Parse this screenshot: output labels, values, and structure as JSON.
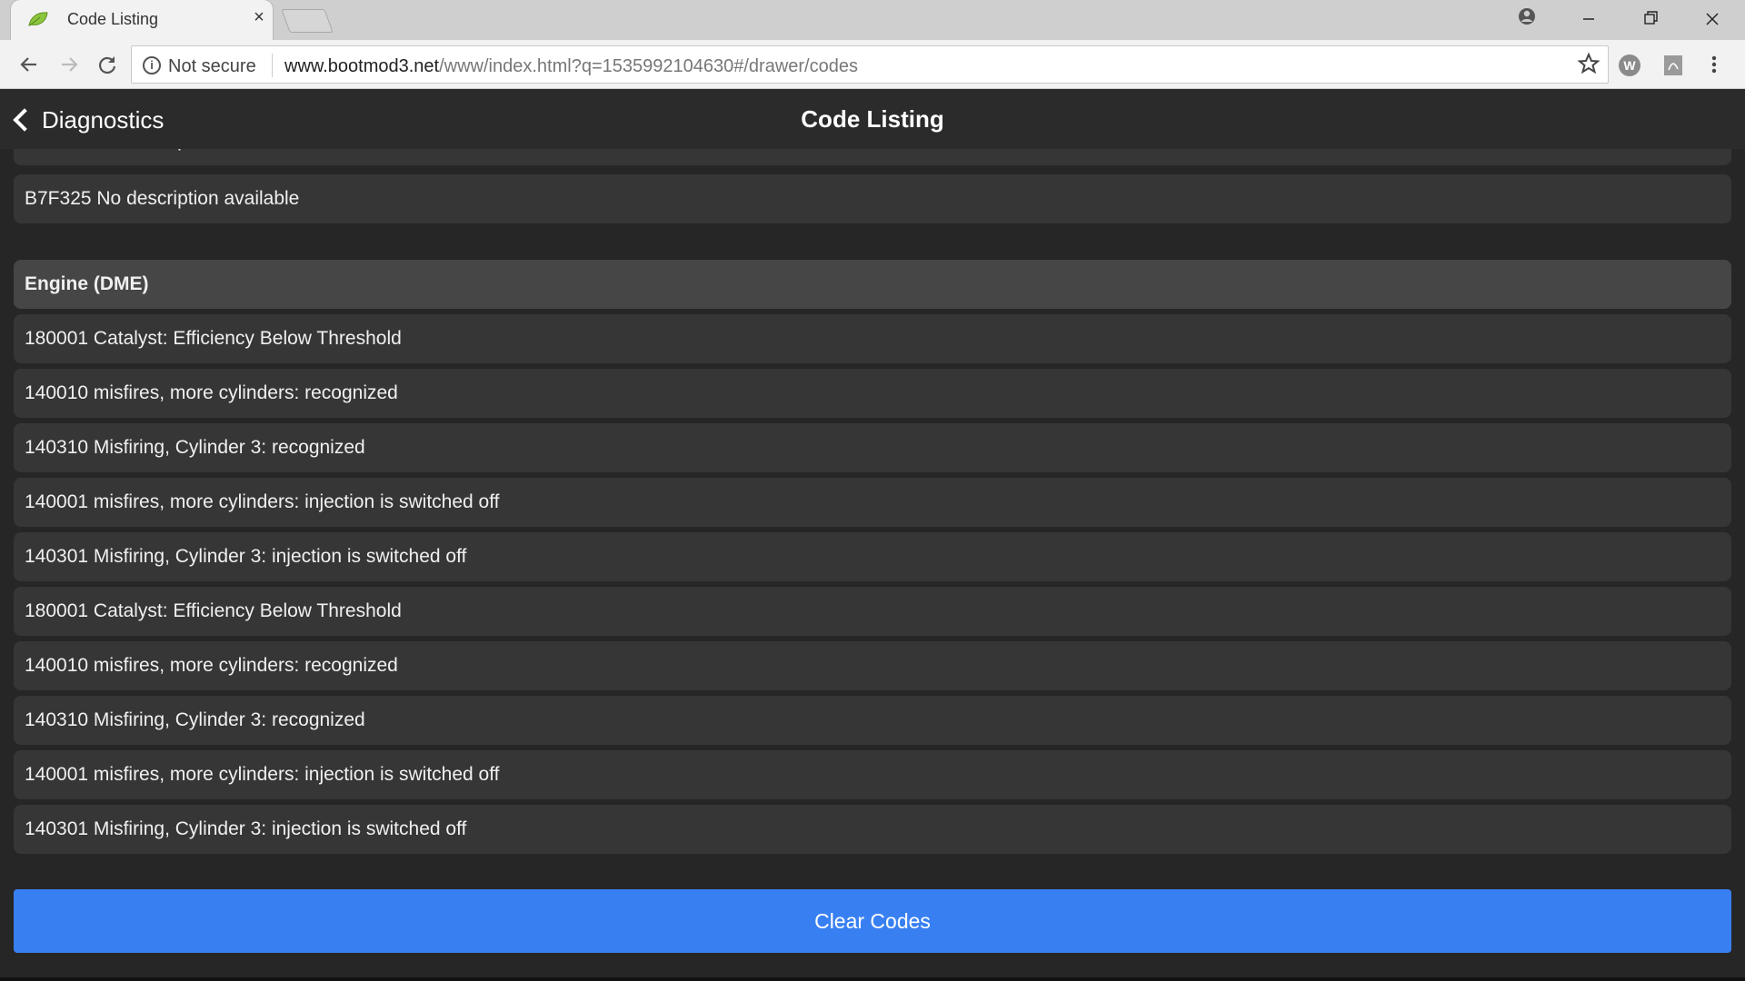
{
  "browser": {
    "tab_title": "Code Listing",
    "tab_close": "×",
    "not_secure": "Not secure",
    "url_host": "www.bootmod3.net",
    "url_path": "/www/index.html?q=1535992104630#/drawer/codes"
  },
  "header": {
    "back_label": "Diagnostics",
    "title": "Code Listing"
  },
  "codes": {
    "partial_row": "B7F325 No description available",
    "first_row": "B7F325 No description available",
    "section_title": "Engine (DME)",
    "items": [
      "180001 Catalyst: Efficiency Below Threshold",
      "140010 misfires, more cylinders: recognized",
      "140310 Misfiring, Cylinder 3: recognized",
      "140001 misfires, more cylinders: injection is switched off",
      "140301 Misfiring, Cylinder 3: injection is switched off",
      "180001 Catalyst: Efficiency Below Threshold",
      "140010 misfires, more cylinders: recognized",
      "140310 Misfiring, Cylinder 3: recognized",
      "140001 misfires, more cylinders: injection is switched off",
      "140301 Misfiring, Cylinder 3: injection is switched off"
    ]
  },
  "actions": {
    "clear_codes": "Clear Codes"
  },
  "colors": {
    "accent": "#3880f2",
    "background": "#262626",
    "row": "#363636",
    "section_row": "#464646"
  }
}
